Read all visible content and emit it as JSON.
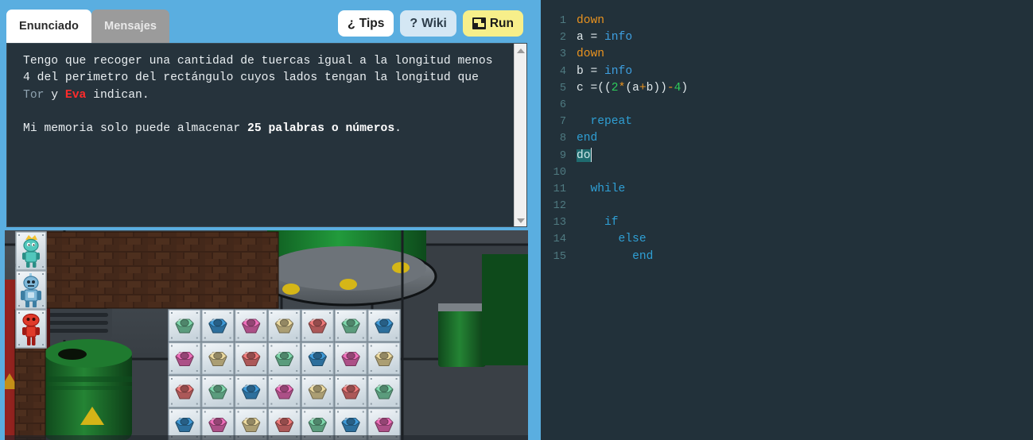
{
  "theme": {
    "page_bg": "#5aaee0",
    "panel_dark": "#26333c",
    "code_bg": "#22313a",
    "accent_run": "#f7ef8a",
    "accent_wiki": "#d4e7f4",
    "keyword_blue": "#2f9fd4",
    "command_orange": "#e8921f",
    "number_green": "#2ecc5b"
  },
  "tabs": [
    {
      "label": "Enunciado",
      "active": true
    },
    {
      "label": "Mensajes",
      "active": false
    }
  ],
  "toolbar": {
    "tips_label": "Tips",
    "tips_icon": "inverted-question-mark-icon",
    "wiki_label": "Wiki",
    "wiki_icon": "question-mark-icon",
    "run_label": "Run",
    "run_icon": "checkered-flag-icon"
  },
  "statement": {
    "paragraph1_part1": "Tengo que recoger una cantidad de tuercas igual a la longitud menos 4 del perimetro del rectángulo cuyos lados tengan la longitud que ",
    "name_tor": "Tor",
    "paragraph1_part2": " y ",
    "name_eva": "Eva",
    "paragraph1_part3": " indican.",
    "paragraph2_part1": "Mi memoria solo puede almacenar ",
    "paragraph2_bold": "25 palabras o números",
    "paragraph2_part2": "."
  },
  "code": {
    "lines": [
      {
        "n": "1",
        "indent": 0,
        "tokens": [
          {
            "t": "down",
            "c": "k-cmd"
          }
        ]
      },
      {
        "n": "2",
        "indent": 0,
        "tokens": [
          {
            "t": "a",
            "c": "k-ident"
          },
          {
            "t": " = ",
            "c": "k-punc"
          },
          {
            "t": "info",
            "c": "k-info"
          }
        ]
      },
      {
        "n": "3",
        "indent": 0,
        "tokens": [
          {
            "t": "down",
            "c": "k-cmd"
          }
        ]
      },
      {
        "n": "4",
        "indent": 0,
        "tokens": [
          {
            "t": "b",
            "c": "k-ident"
          },
          {
            "t": " = ",
            "c": "k-punc"
          },
          {
            "t": "info",
            "c": "k-info"
          }
        ]
      },
      {
        "n": "5",
        "indent": 0,
        "tokens": [
          {
            "t": "c",
            "c": "k-ident"
          },
          {
            "t": " =((",
            "c": "k-punc"
          },
          {
            "t": "2",
            "c": "k-num"
          },
          {
            "t": "*",
            "c": "k-op"
          },
          {
            "t": "(a",
            "c": "k-punc"
          },
          {
            "t": "+",
            "c": "k-op"
          },
          {
            "t": "b))",
            "c": "k-punc"
          },
          {
            "t": "-",
            "c": "k-op"
          },
          {
            "t": "4",
            "c": "k-num"
          },
          {
            "t": ")",
            "c": "k-punc"
          }
        ]
      },
      {
        "n": "6",
        "indent": 0,
        "tokens": []
      },
      {
        "n": "7",
        "indent": 1,
        "tokens": [
          {
            "t": "repeat",
            "c": "k-kw"
          }
        ]
      },
      {
        "n": "8",
        "indent": 0,
        "tokens": [
          {
            "t": "end",
            "c": "k-kw"
          }
        ]
      },
      {
        "n": "9",
        "indent": 0,
        "selected": true,
        "caret": true,
        "tokens": [
          {
            "t": "do",
            "c": "k-kw sel"
          }
        ]
      },
      {
        "n": "10",
        "indent": 0,
        "tokens": []
      },
      {
        "n": "11",
        "indent": 1,
        "tokens": [
          {
            "t": "while",
            "c": "k-kw"
          }
        ]
      },
      {
        "n": "12",
        "indent": 0,
        "tokens": []
      },
      {
        "n": "13",
        "indent": 2,
        "tokens": [
          {
            "t": "if",
            "c": "k-kw"
          }
        ]
      },
      {
        "n": "14",
        "indent": 3,
        "tokens": [
          {
            "t": "else",
            "c": "k-kw"
          }
        ]
      },
      {
        "n": "15",
        "indent": 4,
        "tokens": [
          {
            "t": "end",
            "c": "k-kw"
          }
        ]
      }
    ]
  },
  "game": {
    "scene_name": "factory-floor",
    "characters": [
      {
        "name": "alien-character",
        "colors": {
          "body": "#52c7bc",
          "dark": "#2a8e86",
          "accent": "#f2c230"
        }
      },
      {
        "name": "blue-robot-character",
        "colors": {
          "body": "#7fb8d8",
          "dark": "#3d7ea3",
          "accent": "#c8e2f0"
        }
      },
      {
        "name": "red-robot-character",
        "colors": {
          "body": "#e03a2a",
          "dark": "#a01a14",
          "accent": "#ff8070"
        }
      }
    ],
    "nut_colors": {
      "green": "#7fd8ad",
      "blue": "#3f9ad8",
      "pink": "#ef6fbb",
      "gold": "#eddba0",
      "red": "#ef7a7a"
    },
    "grid": {
      "rows": 4,
      "cols": 7,
      "cells": [
        [
          "green",
          "blue",
          "pink",
          "gold",
          "red",
          "green",
          "blue"
        ],
        [
          "pink",
          "gold",
          "red",
          "green",
          "blue",
          "pink",
          "gold"
        ],
        [
          "red",
          "green",
          "blue",
          "pink",
          "gold",
          "red",
          "green"
        ],
        [
          "blue",
          "pink",
          "gold",
          "red",
          "green",
          "blue",
          "pink"
        ]
      ]
    },
    "background": {
      "floor": "#3c4349",
      "tank_green": "#1c7a34",
      "barrel_red": "#8d2020",
      "barrel_green": "#20702c",
      "brick_dark": "#3a2216",
      "brick_light": "#5a3a26"
    }
  },
  "scrollbars": {
    "statement_up_icon": "triangle-up-icon",
    "statement_down_icon": "triangle-down-icon"
  }
}
